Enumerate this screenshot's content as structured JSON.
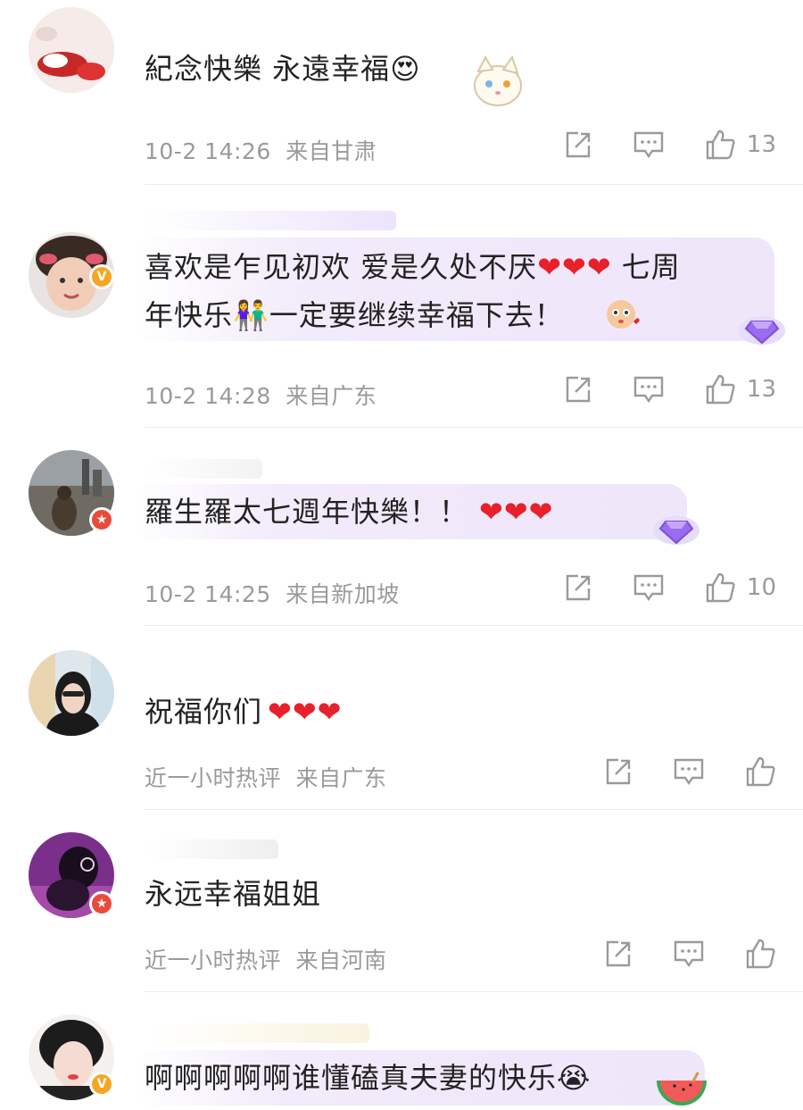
{
  "comments": [
    {
      "text": "紀念快樂 永遠幸福",
      "emoji": "😍",
      "time": "10-2 14:26",
      "location": "来自甘肃",
      "likes": "13",
      "badge": "none"
    },
    {
      "text_line1": "喜欢是乍见初欢 爱是久处不厌",
      "hearts": "❤❤❤",
      "text_line1_end": "七周",
      "text_line2_start": "年快乐",
      "couple_emoji": "👫",
      "text_line2_end": "一定要继续幸福下去！",
      "time": "10-2 14:28",
      "location": "来自广东",
      "likes": "13",
      "badge": "v"
    },
    {
      "text": "羅生羅太七週年快樂！！",
      "hearts": "❤❤❤",
      "time": "10-2 14:25",
      "location": "来自新加坡",
      "likes": "10",
      "badge": "star"
    },
    {
      "text": "祝福你们",
      "hearts": "❤❤❤",
      "time": "近一小时热评",
      "location": "来自广东",
      "likes": "",
      "badge": "none"
    },
    {
      "text": "永远幸福姐姐",
      "time": "近一小时热评",
      "location": "来自河南",
      "likes": "",
      "badge": "star"
    },
    {
      "text": "啊啊啊啊啊谁懂磕真夫妻的快乐",
      "emoji": "😭",
      "badge": "v"
    }
  ],
  "icons": {
    "share": "share-icon",
    "reply": "comment-icon",
    "like": "thumbs-up-icon",
    "verified": "verified-v-icon",
    "star": "star-badge-icon",
    "diamond": "diamond-icon"
  },
  "colors": {
    "text": "#222222",
    "meta": "#9a9a9a",
    "heart": "#e8202a",
    "badge_v": "#f5a623",
    "badge_star": "#e94a3b",
    "bubble": "#efe6fa",
    "diamond": "#9b6cf0"
  }
}
